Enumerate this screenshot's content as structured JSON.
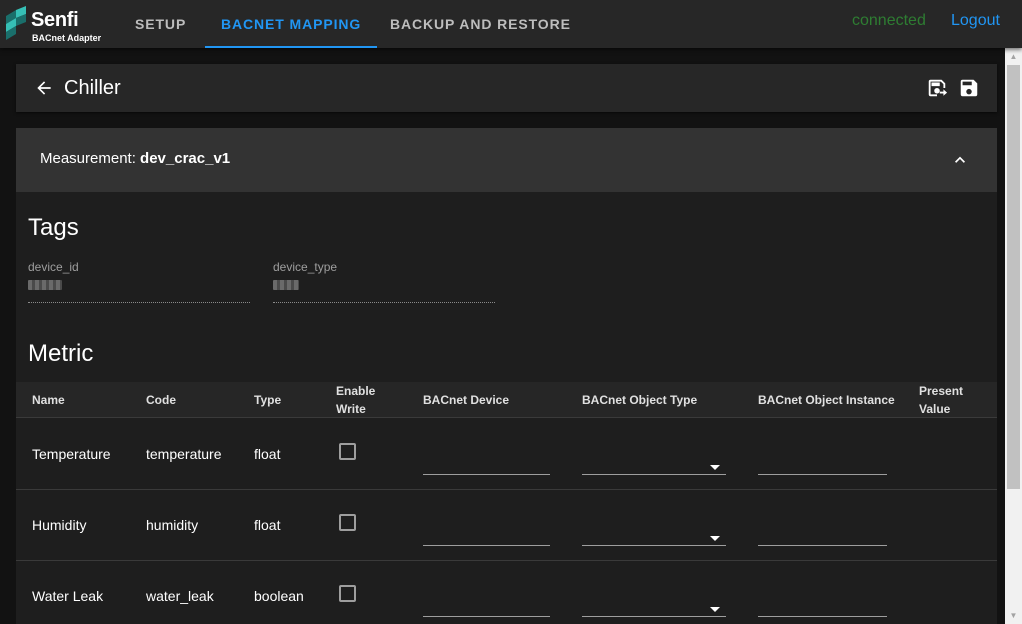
{
  "app": {
    "brand": "Senfi",
    "subtitle": "BACnet Adapter",
    "brand_colors": [
      "#1a6f6b",
      "#36c0b6"
    ]
  },
  "nav": {
    "tabs": [
      {
        "label": "SETUP",
        "active": false
      },
      {
        "label": "BACNET MAPPING",
        "active": true
      },
      {
        "label": "BACKUP AND RESTORE",
        "active": false
      }
    ],
    "connection_status": "connected",
    "logout_label": "Logout"
  },
  "page": {
    "title": "Chiller",
    "actions": [
      "save-as-icon",
      "save-icon"
    ]
  },
  "measurement": {
    "label": "Measurement:",
    "value": "dev_crac_v1",
    "expanded": true
  },
  "tags": {
    "title": "Tags",
    "fields": [
      {
        "label": "device_id",
        "value_redacted": true
      },
      {
        "label": "device_type",
        "value_redacted": true
      }
    ]
  },
  "metric": {
    "title": "Metric",
    "columns": [
      "Name",
      "Code",
      "Type",
      "Enable Write",
      "BACnet Device",
      "BACnet Object Type",
      "BACnet Object Instance",
      "Present Value"
    ],
    "rows": [
      {
        "name": "Temperature",
        "code": "temperature",
        "type": "float",
        "enable_write": false,
        "bacnet_device": "",
        "bacnet_object_type": "",
        "bacnet_object_instance": "",
        "present_value": ""
      },
      {
        "name": "Humidity",
        "code": "humidity",
        "type": "float",
        "enable_write": false,
        "bacnet_device": "",
        "bacnet_object_type": "",
        "bacnet_object_instance": "",
        "present_value": ""
      },
      {
        "name": "Water Leak",
        "code": "water_leak",
        "type": "boolean",
        "enable_write": false,
        "bacnet_device": "",
        "bacnet_object_type": "",
        "bacnet_object_instance": "",
        "present_value": ""
      }
    ]
  },
  "colors": {
    "accent": "#2196f3",
    "connected": "#2e7d32",
    "surface": "#272727",
    "background": "#121212"
  }
}
